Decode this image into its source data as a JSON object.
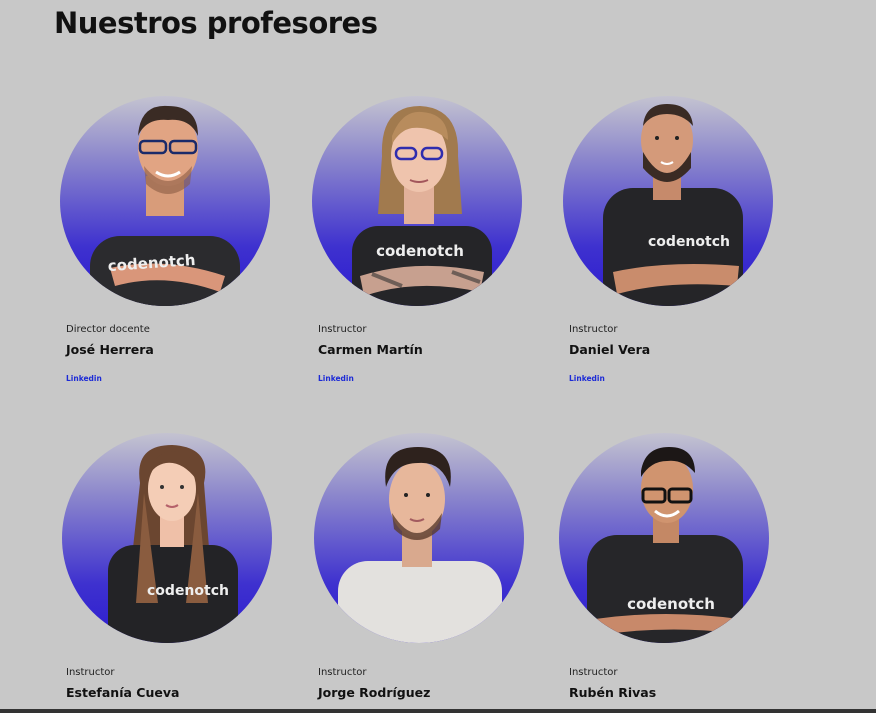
{
  "page": {
    "title": "Nuestros profesores"
  },
  "teachers": [
    {
      "role": "Director docente",
      "name": "José Herrera",
      "link": "Linkedin",
      "shirt_text": "codenotch"
    },
    {
      "role": "Instructor",
      "name": "Carmen Martín",
      "link": "Linkedin",
      "shirt_text": "codenotch"
    },
    {
      "role": "Instructor",
      "name": "Daniel Vera",
      "link": "Linkedin",
      "shirt_text": "codenotch"
    },
    {
      "role": "Instructor",
      "name": "Estefanía Cueva",
      "shirt_text": "codenotch"
    },
    {
      "role": "Instructor",
      "name": "Jorge Rodríguez"
    },
    {
      "role": "Instructor",
      "name": "Rubén Rivas",
      "shirt_text": "codenotch"
    }
  ],
  "colors": {
    "gradient_top": "#c4c3d0",
    "gradient_bottom": "#2c1bd0",
    "link": "#1d2bd6",
    "background": "#c8c8c8"
  }
}
